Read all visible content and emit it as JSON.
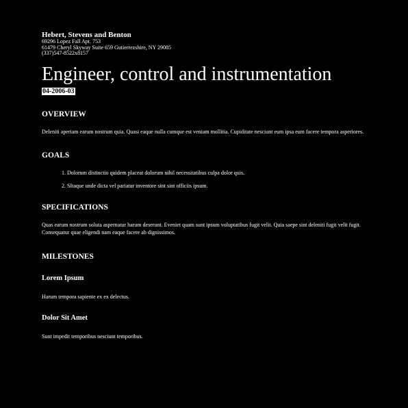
{
  "header": {
    "company": "Hebert, Stevens and Benton",
    "address_lines": [
      "69296 Lopez Fall Apt. 753",
      "61479 Cheryl Skyway Suite 659 Gutierrezshire, NY 29085",
      "(337)547-8522x8157"
    ]
  },
  "title": "Engineer, control and instrumentation",
  "date": "04-2006-03",
  "overview": {
    "heading": "OVERVIEW",
    "text": "Deleniti aperiam earum nostrum quia. Quasi eaque nulla cumque est veniam mollitia. Cupiditate nesciunt eum ipsa eum facere tempora asperiores."
  },
  "goals": {
    "heading": "GOALS",
    "items": [
      "Dolorum distinctio quidem placeat dolorum nihil necessitatibus culpa dolor quis.",
      "SItaque unde dicta vel pariatur inventore sint sint officiis ipsum."
    ]
  },
  "specifications": {
    "heading": "SPECIFICATIONS",
    "text": "Quas earum nostrum soluta aspernatur harum deserunt. Eveniet quam sunt ipsum voluptatibus fugit velit. Quia saepe sint deleniti fugit velit fugit. Consequatur quae eligendi nam eaque facere ab dignissimos."
  },
  "milestones": {
    "heading": "MILESTONES",
    "items": [
      {
        "title": "Lorem Ipsum",
        "text": "Harum tempora sapiente ex ex delectus."
      },
      {
        "title": "Dolor Sit Amet",
        "text": "Sunt impedit temporibus nesciunt temporibus."
      }
    ]
  }
}
